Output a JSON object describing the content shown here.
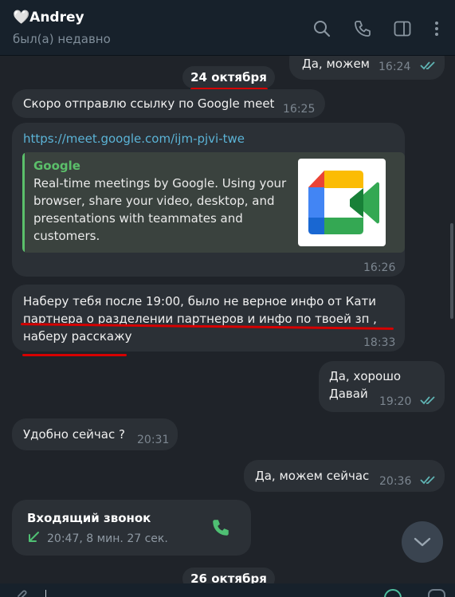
{
  "header": {
    "name": "🤍Andrey",
    "status": "был(а) недавно"
  },
  "icons": [
    "search-icon",
    "phone-icon",
    "sidebar-toggle-icon",
    "more-vertical-icon"
  ],
  "messages": {
    "m0": {
      "text": "Да, можем",
      "time": "16:24"
    },
    "date1": "24 октября",
    "m1": {
      "text": "Скоро отправлю ссылку по Google meet",
      "time": "16:25"
    },
    "m2": {
      "link": "https://meet.google.com/ijm-pjvi-twe",
      "preview_site": "Google",
      "preview_desc": "Real-time meetings by Google. Using your browser, share your video, desktop, and presentations with teammates and customers.",
      "time": "16:26"
    },
    "m3": {
      "line1": "Наберу тебя после 19:00, было не верное инфо от Кати",
      "line2": "партнера о разделении партнеров и инфо по твоей зп ,",
      "line3": "наберу расскажу",
      "time": "18:33"
    },
    "m4": {
      "line1": "Да, хорошо",
      "line2": "Давай",
      "time": "19:20"
    },
    "m5": {
      "text": "Удобно сейчас ?",
      "time": "20:31"
    },
    "m6": {
      "text": "Да, можем сейчас",
      "time": "20:36"
    },
    "m7": {
      "title": "Входящий звонок",
      "info": "20:47, 8 мин. 27 сек."
    },
    "date2": "26 октября"
  },
  "colors": {
    "header_bg": "#17212b",
    "chat_bg": "#1f2329",
    "bubble_bg": "#2b3036",
    "link": "#5bb3d6",
    "read_ticks": "#5fb3b3",
    "annotation_red": "#d60000",
    "call_green": "#4fbf73"
  }
}
